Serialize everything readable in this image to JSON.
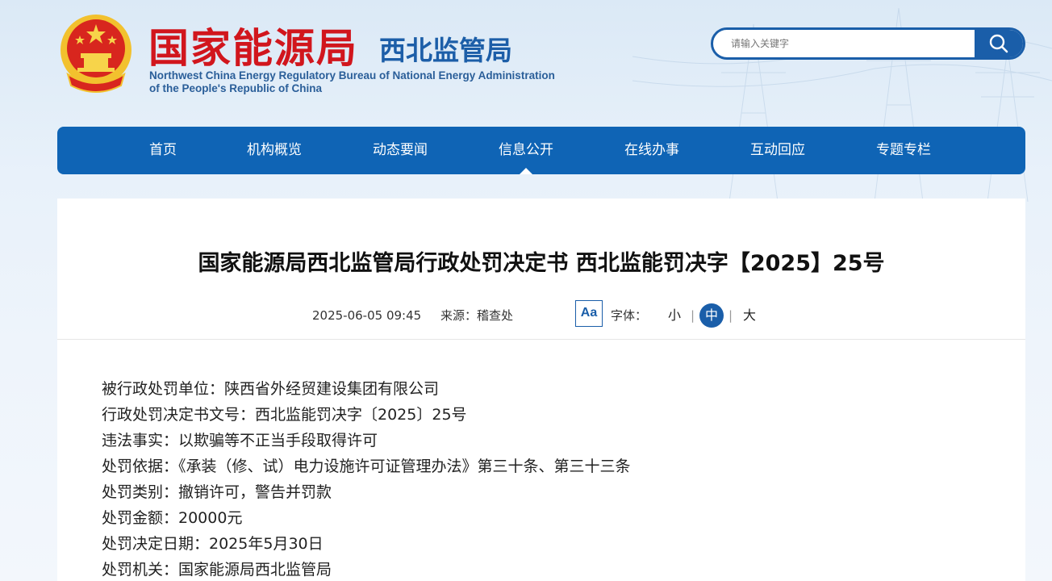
{
  "header": {
    "logo_cn": "国家能源局",
    "logo_sub": "西北监管局",
    "logo_en_line1": "Northwest China Energy Regulatory Bureau of National Energy Administration",
    "logo_en_line2": "of the People's Republic of China"
  },
  "search": {
    "placeholder": "请输入关键字"
  },
  "nav": {
    "items": [
      "首页",
      "机构概览",
      "动态要闻",
      "信息公开",
      "在线办事",
      "互动回应",
      "专题专栏"
    ],
    "active": "信息公开"
  },
  "article": {
    "title": "国家能源局西北监管局行政处罚决定书 西北监能罚决字【2025】25号",
    "date": "2025-06-05 09:45",
    "source": "来源：稽查处",
    "aa_label": "Aa",
    "font_label": "字体：",
    "font_small": "小",
    "font_medium": "中",
    "font_large": "大",
    "lines": [
      "被行政处罚单位：陕西省外经贸建设集团有限公司",
      "行政处罚决定书文号：西北监能罚决字〔2025〕25号",
      "违法事实：以欺骗等不正当手段取得许可",
      "处罚依据：《承装（修、试）电力设施许可证管理办法》第三十条、第三十三条",
      "处罚类别：撤销许可，警告并罚款",
      "处罚金额：20000元",
      "处罚决定日期：2025年5月30日",
      "处罚机关：国家能源局西北监管局"
    ]
  },
  "colors": {
    "brand_red": "#d1161d",
    "brand_blue": "#0f64b5"
  }
}
